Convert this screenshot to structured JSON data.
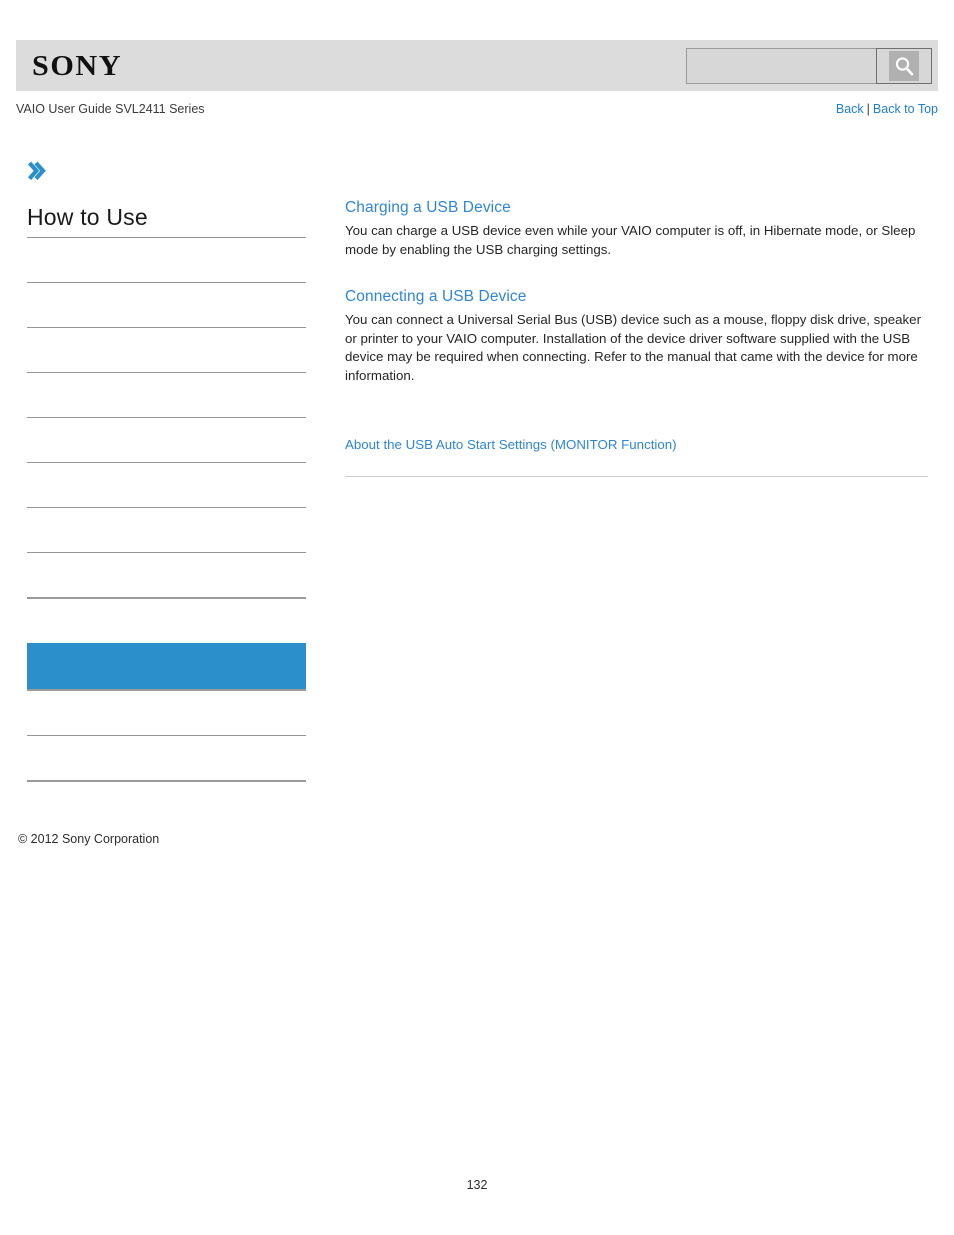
{
  "page": {
    "number": "132",
    "copyright": "© 2012 Sony Corporation",
    "background": "#ffffff"
  },
  "header": {
    "logo": "SONY",
    "logo_icon": "sony-wordmark",
    "bar_color": "#dcdcdc",
    "search": {
      "value": "",
      "placeholder": "",
      "button_icon": "magnifier-icon"
    }
  },
  "subheader": {
    "guide_title": "VAIO User Guide SVL2411 Series",
    "links": [
      {
        "label": "Back"
      },
      {
        "label": "Back to Top"
      }
    ],
    "separator": "|"
  },
  "sidebar": {
    "breadcrumb_icon": "double-chevron-right-icon",
    "heading": "How to Use",
    "accent_color": "#2b8fcc",
    "separator_color": "#949494",
    "items": [
      {
        "label": "",
        "active": false,
        "separator": "thin"
      },
      {
        "label": "",
        "active": false,
        "separator": "thin"
      },
      {
        "label": "",
        "active": false,
        "separator": "thin"
      },
      {
        "label": "",
        "active": false,
        "separator": "thin"
      },
      {
        "label": "",
        "active": false,
        "separator": "thin"
      },
      {
        "label": "",
        "active": false,
        "separator": "thin"
      },
      {
        "label": "",
        "active": false,
        "separator": "thin"
      },
      {
        "label": "",
        "active": false,
        "separator": "thick"
      },
      {
        "label": "",
        "active": true,
        "separator": "thick"
      },
      {
        "label": "",
        "active": false,
        "separator": "thin"
      },
      {
        "label": "",
        "active": false,
        "separator": "thick"
      }
    ]
  },
  "main": {
    "sections": [
      {
        "title": "Charging a USB Device",
        "body": "You can charge a USB device even while your VAIO computer is off, in Hibernate mode, or Sleep mode by enabling the USB charging settings."
      },
      {
        "title": "Connecting a USB Device",
        "body": "You can connect a Universal Serial Bus (USB) device such as a mouse, floppy disk drive, speaker or printer to your VAIO computer. Installation of the device driver software supplied with the USB device may be required when connecting. Refer to the manual that came with the device for more information."
      }
    ],
    "related_links": [
      {
        "label": "About the USB Auto Start Settings (MONITOR Function)"
      }
    ],
    "link_color": "#2f86d8"
  }
}
